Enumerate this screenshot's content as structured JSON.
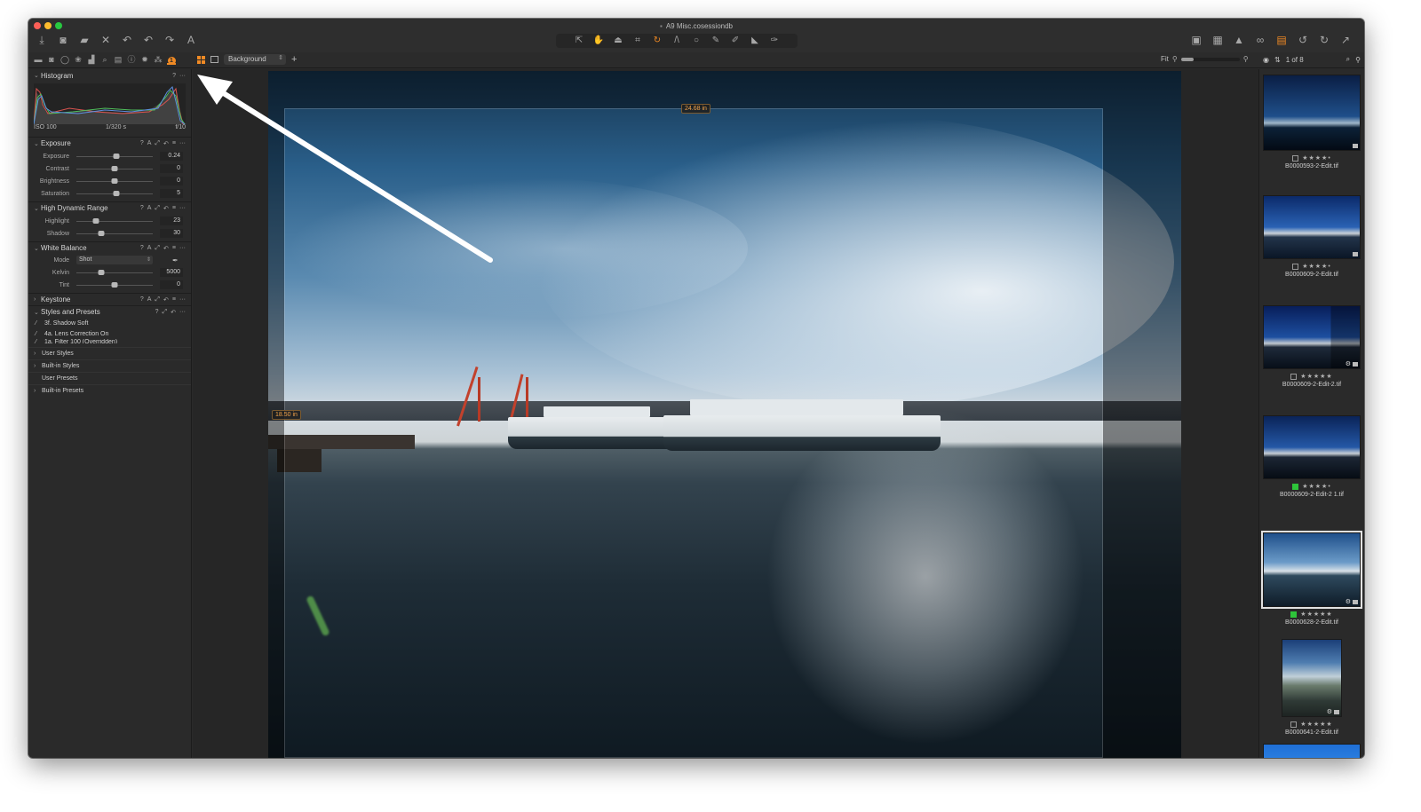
{
  "window": {
    "title": "A9 Misc.cosessiondb"
  },
  "toolbar": {
    "left": [
      {
        "name": "import-icon",
        "glyph": "⤓"
      },
      {
        "name": "camera-icon",
        "glyph": "◙"
      },
      {
        "name": "folder-export-icon",
        "glyph": "▰"
      },
      {
        "name": "delete-icon",
        "glyph": "✕"
      },
      {
        "name": "undo-all-icon",
        "glyph": "↶"
      },
      {
        "name": "undo-icon",
        "glyph": "↶"
      },
      {
        "name": "redo-icon",
        "glyph": "↷"
      },
      {
        "name": "text-tool-icon",
        "glyph": "A"
      }
    ],
    "center_tools": [
      {
        "name": "select-tool-icon",
        "glyph": "⇱"
      },
      {
        "name": "pan-tool-icon",
        "glyph": "✋"
      },
      {
        "name": "loupe-tool-icon",
        "glyph": "⏏"
      },
      {
        "name": "crop-tool-icon",
        "glyph": "⌗"
      },
      {
        "name": "rotate-tool-icon",
        "glyph": "↻",
        "active": true
      },
      {
        "name": "keystone-tool-icon",
        "glyph": "/\\"
      },
      {
        "name": "spot-removal-icon",
        "glyph": "○"
      },
      {
        "name": "color-picker-icon",
        "glyph": "✎"
      },
      {
        "name": "brush-icon",
        "glyph": "✐"
      },
      {
        "name": "gradient-mask-icon",
        "glyph": "◣"
      },
      {
        "name": "eraser-icon",
        "glyph": "✑"
      }
    ],
    "right": [
      {
        "name": "edit-mask-icon",
        "glyph": "▣"
      },
      {
        "name": "grid-overlay-icon",
        "glyph": "▦"
      },
      {
        "name": "exposure-warning-icon",
        "glyph": "▲"
      },
      {
        "name": "proof-glasses-icon",
        "glyph": "∞"
      },
      {
        "name": "copy-adjustments-icon",
        "glyph": "▤",
        "accent": true
      },
      {
        "name": "rotate-left-icon",
        "glyph": "↺"
      },
      {
        "name": "rotate-right-icon",
        "glyph": "↻"
      },
      {
        "name": "apply-adjustments-icon",
        "glyph": "↗"
      }
    ]
  },
  "tool_tabs": [
    {
      "name": "library-tab-icon",
      "glyph": "▬"
    },
    {
      "name": "capture-tab-icon",
      "glyph": "◙"
    },
    {
      "name": "lens-tab-icon",
      "glyph": "◯"
    },
    {
      "name": "color-tab-icon",
      "glyph": "❀"
    },
    {
      "name": "exposure-tab-icon",
      "glyph": "▟"
    },
    {
      "name": "details-tab-icon",
      "glyph": "⌕"
    },
    {
      "name": "adjustments-tab-icon",
      "glyph": "▤"
    },
    {
      "name": "metadata-tab-icon",
      "glyph": "ⓘ"
    },
    {
      "name": "output-tab-icon",
      "glyph": "✹"
    },
    {
      "name": "batch-tab-icon",
      "glyph": "⁂"
    },
    {
      "name": "quick-tab-icon",
      "badge": "1",
      "active": true
    }
  ],
  "viewer_bar": {
    "layer": "Background",
    "zoom_label": "Fit",
    "zoom_fraction": 0.22
  },
  "browser_bar": {
    "counter": "1 of 8"
  },
  "histogram": {
    "title": "Histogram",
    "iso": "ISO 100",
    "shutter": "1/320 s",
    "aperture": "f/10"
  },
  "exposure": {
    "title": "Exposure",
    "sliders": [
      {
        "label": "Exposure",
        "value": "0.24",
        "pos": 0.52
      },
      {
        "label": "Contrast",
        "value": "0",
        "pos": 0.5
      },
      {
        "label": "Brightness",
        "value": "0",
        "pos": 0.5
      },
      {
        "label": "Saturation",
        "value": "5",
        "pos": 0.52
      }
    ]
  },
  "hdr": {
    "title": "High Dynamic Range",
    "sliders": [
      {
        "label": "Highlight",
        "value": "23",
        "pos": 0.26
      },
      {
        "label": "Shadow",
        "value": "30",
        "pos": 0.32
      }
    ]
  },
  "white_balance": {
    "title": "White Balance",
    "mode_label": "Mode",
    "mode_value": "Shot",
    "sliders": [
      {
        "label": "Kelvin",
        "value": "5000",
        "pos": 0.33
      },
      {
        "label": "Tint",
        "value": "0",
        "pos": 0.5
      }
    ]
  },
  "keystone": {
    "title": "Keystone"
  },
  "styles": {
    "title": "Styles and Presets",
    "applied": [
      "3f. Shadow Soft",
      "4a. Lens Correction On",
      "1a. Filter 100 (Overridden)"
    ],
    "groups": [
      {
        "label": "User Styles",
        "chevron": true
      },
      {
        "label": "Built-in Styles",
        "chevron": true
      },
      {
        "label": "User Presets",
        "chevron": false
      },
      {
        "label": "Built-in Presets",
        "chevron": true
      }
    ]
  },
  "section_actions": {
    "help": "?",
    "auto": "A",
    "copy": "⤢",
    "reset": "↶",
    "presets": "≡",
    "more": "···"
  },
  "crop": {
    "width_label": "24.68 in",
    "height_label": "18.50 in"
  },
  "thumbnails": [
    {
      "filename": "B0000593-2-Edit.tif",
      "stars": "★★★★•",
      "color_tag": "none",
      "selected": false
    },
    {
      "filename": "B0000609-2-Edit.tif",
      "stars": "★★★★•",
      "color_tag": "none",
      "selected": false
    },
    {
      "filename": "B0000609-2-Edit-2.tif",
      "stars": "★★★★★",
      "color_tag": "none",
      "selected": false
    },
    {
      "filename": "B0000609-2-Edit-2 1.tif",
      "stars": "★★★★•",
      "color_tag": "green",
      "selected": false
    },
    {
      "filename": "B0000628-2-Edit.tif",
      "stars": "★★★★★",
      "color_tag": "green",
      "selected": true
    },
    {
      "filename": "B0000641-2-Edit.tif",
      "stars": "★★★★★",
      "color_tag": "none",
      "selected": false
    }
  ],
  "colors": {
    "accent": "#f08a24",
    "green_tag": "#2ec43a",
    "panel_bg": "#2a2a2a"
  }
}
